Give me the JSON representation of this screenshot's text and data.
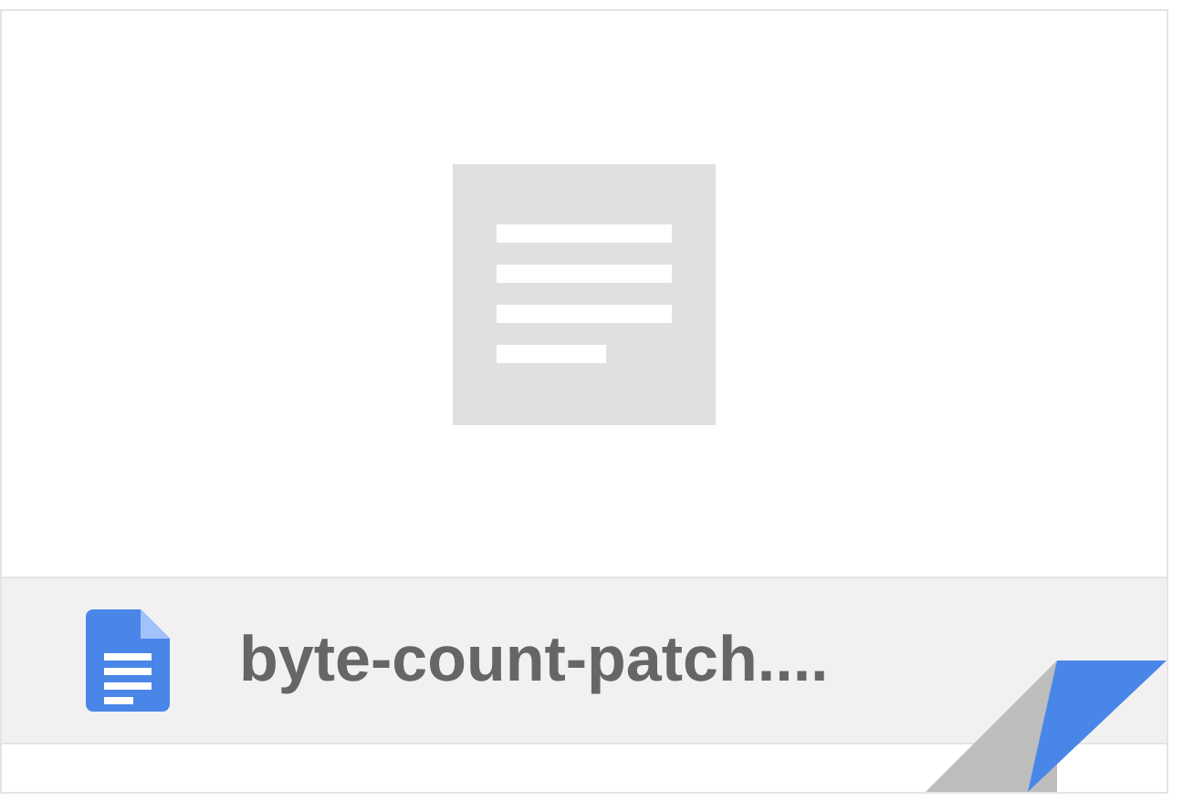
{
  "file": {
    "name": "byte-count-patch....",
    "kind": "document"
  }
}
